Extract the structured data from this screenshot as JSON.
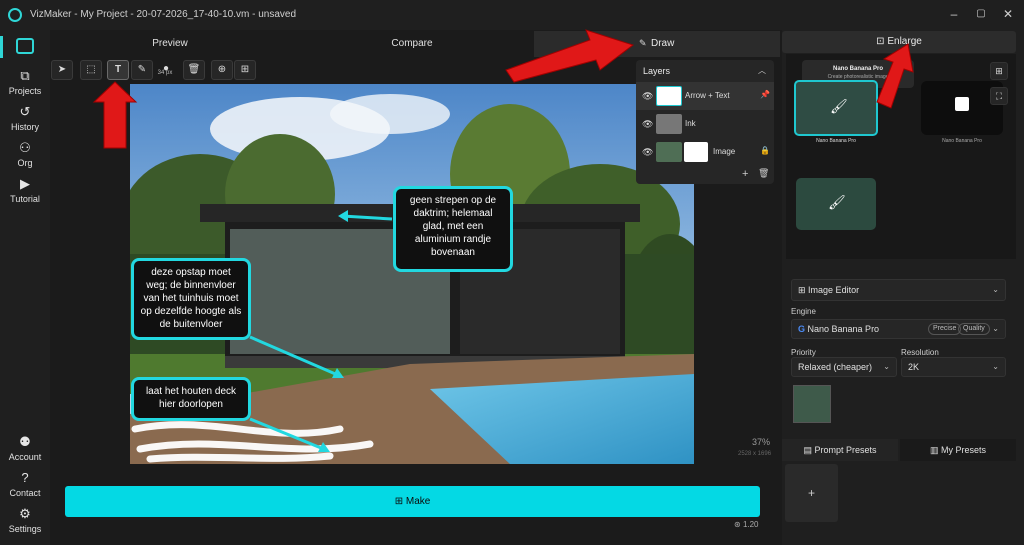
{
  "window": {
    "title": "VizMaker - My Project - 20-07-2026_17-40-10.vm - unsaved",
    "controls": [
      "–",
      "▢",
      "✕"
    ]
  },
  "sidebar": {
    "items": [
      {
        "label": "",
        "icon": "home-icon"
      },
      {
        "label": "Projects",
        "icon": "projects-icon"
      },
      {
        "label": "History",
        "icon": "history-icon"
      },
      {
        "label": "Org",
        "icon": "org-icon"
      },
      {
        "label": "Tutorial",
        "icon": "tutorial-icon"
      },
      {
        "label": "Account",
        "icon": "account-icon"
      },
      {
        "label": "Contact",
        "icon": "contact-icon"
      },
      {
        "label": "Settings",
        "icon": "settings-icon"
      }
    ]
  },
  "tabs": {
    "preview": "Preview",
    "compare": "Compare",
    "draw": "Draw",
    "enlarge": "Enlarge"
  },
  "toolbar": {
    "brush_size": "34 px"
  },
  "canvas": {
    "zoom": "37%",
    "dims": "2528 x 1696",
    "callouts": {
      "top": "geen strepen op de daktrim; helemaal glad, met een aluminium randje bovenaan",
      "left": "deze opstap moet weg; de binnenvloer van het tuinhuis moet op dezelfde hoogte als de buitenvloer",
      "bottom": "laat het houten deck hier doorlopen"
    }
  },
  "layers": {
    "title": "Layers",
    "items": [
      {
        "name": "Arrow + Text"
      },
      {
        "name": "Ink"
      },
      {
        "name": "Image"
      }
    ]
  },
  "graph": {
    "node1_title": "Nano Banana Pro",
    "node1_sub": "Create photorealistic image",
    "node2_title": "Nano Banana Pro",
    "node3_title": "Nano Banana Pro"
  },
  "editor": {
    "mode": "Image Editor",
    "engine_label": "Engine",
    "engine": "Nano Banana Pro",
    "badges": [
      "Precise",
      "Quality"
    ],
    "priority_label": "Priority",
    "priority": "Relaxed (cheaper)",
    "resolution_label": "Resolution",
    "resolution": "2K"
  },
  "presets": {
    "prompt": "Prompt Presets",
    "mine": "My Presets",
    "add": "+"
  },
  "make": {
    "label": "Make",
    "version": "1.20"
  },
  "colors": {
    "accent": "#04d9e4",
    "arrow_red": "#e01818"
  }
}
